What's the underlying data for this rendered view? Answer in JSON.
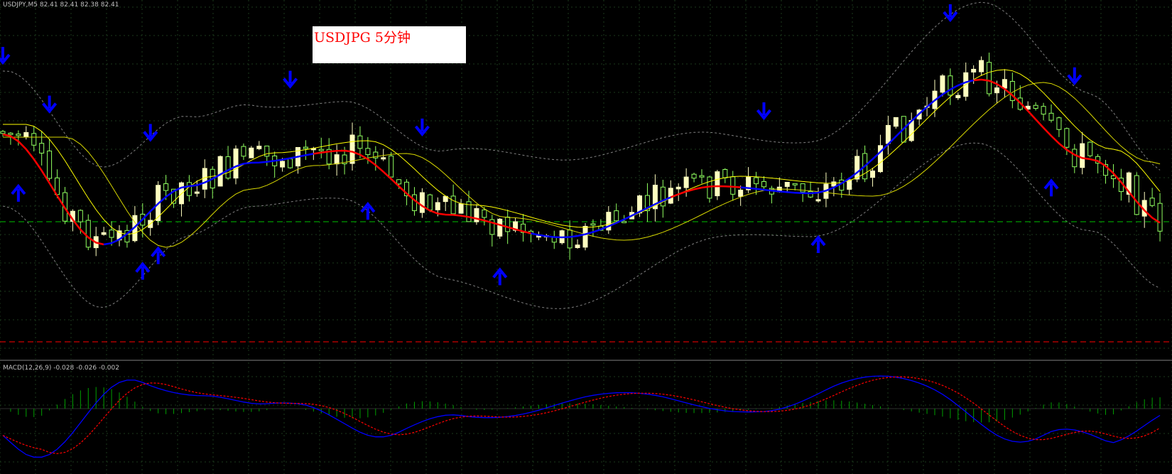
{
  "header": {
    "symbol": "USDJPY,M5",
    "quotes": "82.41 82.41 82.38 82.41"
  },
  "title_box": {
    "text": "USDJPG 5分钟"
  },
  "macd": {
    "label": "MACD(12,26,9) -0.028 -0.026 -0.002"
  },
  "colors": {
    "background": "#000000",
    "grid": "#1c3a1c",
    "bull_candle": "#ffffc0",
    "bear_candle": "#90ff60",
    "ma_fast": "#ffff00",
    "ma_slow": "#d8d800",
    "trend_up": "#0000ff",
    "trend_down": "#ff0000",
    "arrows": "#0000ff",
    "bands": "#808080",
    "level_line": "#00c000",
    "support_line": "#ff0000",
    "macd_line": "#0000ff",
    "macd_signal": "#ff0000",
    "macd_hist": "#00a000"
  },
  "chart_data": {
    "type": "candlestick",
    "symbol": "USDJPY",
    "timeframe": "M5",
    "bars": 150,
    "trend_turning_points": [
      {
        "bar": 0,
        "direction": "down"
      },
      {
        "bar": 13,
        "direction": "up"
      },
      {
        "bar": 40,
        "direction": "down"
      },
      {
        "bar": 68,
        "direction": "up"
      },
      {
        "bar": 86,
        "direction": "down"
      },
      {
        "bar": 95,
        "direction": "up"
      },
      {
        "bar": 125,
        "direction": "down"
      }
    ],
    "signal_arrows": [
      {
        "bar": 0,
        "dir": "down"
      },
      {
        "bar": 6,
        "dir": "down"
      },
      {
        "bar": 2,
        "dir": "up"
      },
      {
        "bar": 18,
        "dir": "up"
      },
      {
        "bar": 19,
        "dir": "down"
      },
      {
        "bar": 20,
        "dir": "up"
      },
      {
        "bar": 37,
        "dir": "down"
      },
      {
        "bar": 47,
        "dir": "up"
      },
      {
        "bar": 54,
        "dir": "down"
      },
      {
        "bar": 64,
        "dir": "up"
      },
      {
        "bar": 98,
        "dir": "down"
      },
      {
        "bar": 105,
        "dir": "up"
      },
      {
        "bar": 122,
        "dir": "down"
      },
      {
        "bar": 135,
        "dir": "up"
      },
      {
        "bar": 138,
        "dir": "down"
      }
    ],
    "indicators": [
      "Bollinger Bands",
      "Moving Averages",
      "MACD(12,26,9)"
    ]
  }
}
